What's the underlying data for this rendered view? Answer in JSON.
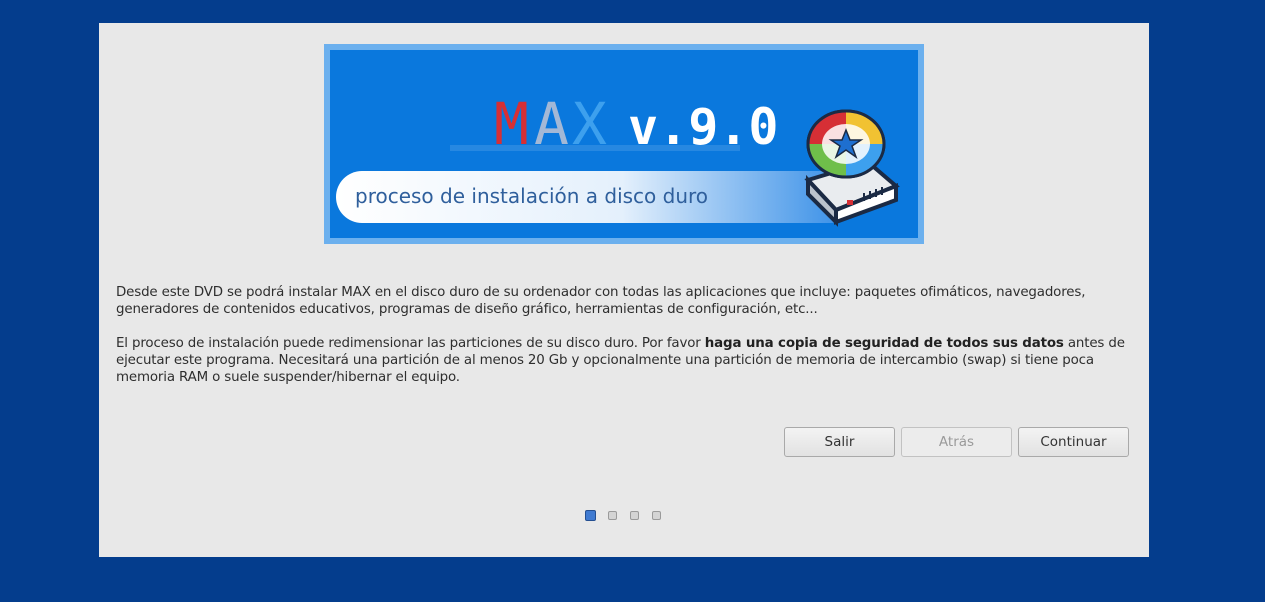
{
  "banner": {
    "logo_m": "M",
    "logo_a": "A",
    "logo_x": "X",
    "version": "v.9.0",
    "subtitle": "proceso de instalación a disco duro",
    "icon": "hard-disk-icon"
  },
  "intro": {
    "paragraph1": "Desde este DVD se podrá instalar MAX en el disco duro de su ordenador con todas las aplicaciones que incluye: paquetes ofimáticos, navegadores, generadores de contenidos educativos, programas de diseño gráfico, herramientas de configuración, etc...",
    "paragraph2_before": "El proceso de instalación puede redimensionar las particiones de su disco duro. Por favor ",
    "paragraph2_bold": "haga una copia de seguridad de todos sus datos",
    "paragraph2_after": " antes de ejecutar este programa. Necesitará una partición de al menos 20 Gb y opcionalmente una partición de memoria de intercambio (swap) si tiene poca memoria RAM o suele suspender/hibernar el equipo."
  },
  "buttons": {
    "quit": "Salir",
    "back": "Atrás",
    "continue": "Continuar"
  },
  "pager": {
    "total_pages": 4,
    "current_page": 1
  },
  "colors": {
    "desktop": "#043d8d",
    "window": "#e8e8e8",
    "banner_blue": "#0a78dd",
    "logo_m": "#d62f35",
    "logo_a": "#a3b8d6",
    "logo_x": "#3da0ee",
    "active_dot": "#3f7ad1"
  }
}
